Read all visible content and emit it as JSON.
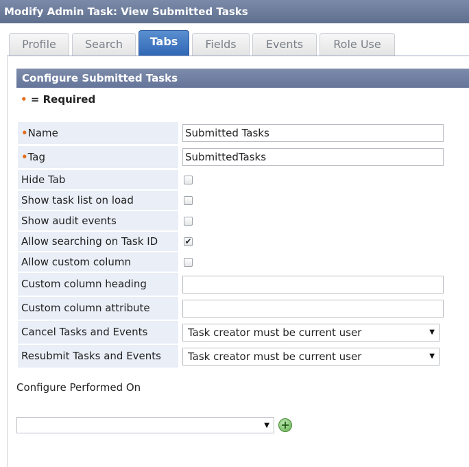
{
  "window": {
    "title": "Modify Admin Task: View Submitted Tasks"
  },
  "tabs": [
    {
      "label": "Profile",
      "active": false
    },
    {
      "label": "Search",
      "active": false
    },
    {
      "label": "Tabs",
      "active": true
    },
    {
      "label": "Fields",
      "active": false
    },
    {
      "label": "Events",
      "active": false
    },
    {
      "label": "Role Use",
      "active": false
    }
  ],
  "section": {
    "title": "Configure Submitted Tasks"
  },
  "required_legend": {
    "marker": "•",
    "text": " = Required"
  },
  "form": {
    "name": {
      "label": "Name",
      "value": "Submitted Tasks",
      "required": true
    },
    "tag": {
      "label": "Tag",
      "value": "SubmittedTasks",
      "required": true
    },
    "checkboxes": [
      {
        "label": "Hide Tab",
        "checked": false
      },
      {
        "label": "Show task list on load",
        "checked": false
      },
      {
        "label": "Show audit events",
        "checked": false
      },
      {
        "label": "Allow searching on Task ID",
        "checked": true
      },
      {
        "label": "Allow custom column",
        "checked": false
      }
    ],
    "custom_heading": {
      "label": "Custom column heading",
      "value": ""
    },
    "custom_attribute": {
      "label": "Custom column attribute",
      "value": ""
    },
    "cancel_tasks": {
      "label": "Cancel Tasks and Events",
      "value": "Task creator must be current user"
    },
    "resubmit_tasks": {
      "label": "Resubmit Tasks and Events",
      "value": "Task creator must be current user"
    }
  },
  "performed_on": {
    "label": "Configure Performed On",
    "value": ""
  },
  "glyphs": {
    "dropdown_arrow": "▼",
    "check": "✔",
    "plus": "+"
  },
  "colors": {
    "required_marker": "#e2701f",
    "active_tab": "#2f66b4",
    "header_bar": "#6f7fa0"
  }
}
